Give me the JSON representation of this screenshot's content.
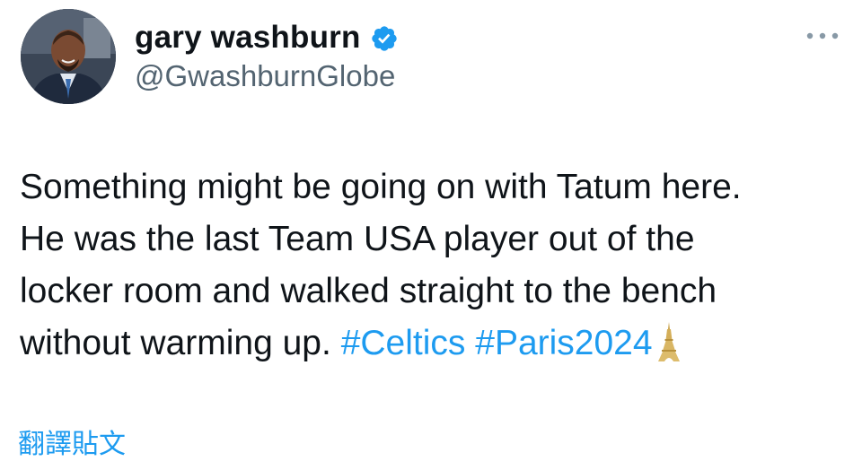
{
  "author": {
    "display_name": "gary washburn",
    "handle": "@GwashburnGlobe",
    "verified": true,
    "avatar_icon": "profile-photo"
  },
  "more_icon": "more-horizontal-icon",
  "tweet": {
    "lines": [
      "Something might be going on with Tatum here.",
      "He was the last Team USA player out of the",
      "locker room and walked straight to the bench",
      "without warming up."
    ],
    "hashtags": [
      "#Celtics",
      "#Paris2024"
    ],
    "emoji": "eiffel-tower-icon"
  },
  "translate_label": "翻譯貼文",
  "colors": {
    "text": "#0f1419",
    "secondary": "#536471",
    "link": "#1d9bf0",
    "verified": "#1d9bf0"
  }
}
